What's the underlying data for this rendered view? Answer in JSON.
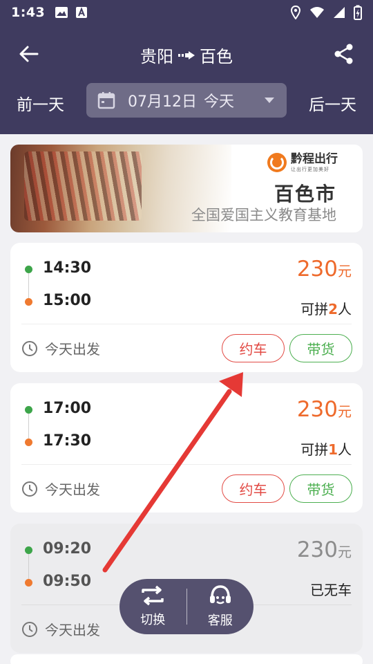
{
  "status_bar": {
    "time": "1:43"
  },
  "header": {
    "origin": "贵阳",
    "destination": "百色",
    "prev_day": "前一天",
    "next_day": "后一天",
    "date": "07月12日",
    "date_tag": "今天"
  },
  "banner": {
    "brand": "黔程出行",
    "brand_sub": "让出行更加美好",
    "city": "百色市",
    "slogan": "全国爱国主义教育基地"
  },
  "trips": [
    {
      "depart_time": "14:30",
      "arrive_time": "15:00",
      "price": "230",
      "unit": "元",
      "seats_prefix": "可拼",
      "seats_count": "2",
      "seats_suffix": "人",
      "depart_label": "今天出发",
      "book_label": "约车",
      "cargo_label": "带货"
    },
    {
      "depart_time": "17:00",
      "arrive_time": "17:30",
      "price": "230",
      "unit": "元",
      "seats_prefix": "可拼",
      "seats_count": "1",
      "seats_suffix": "人",
      "depart_label": "今天出发",
      "book_label": "约车",
      "cargo_label": "带货"
    },
    {
      "depart_time": "09:20",
      "arrive_time": "09:50",
      "price": "230",
      "unit": "元",
      "status": "已无车",
      "depart_label": "今天出发"
    }
  ],
  "float_bar": {
    "switch_label": "切换",
    "service_label": "客服"
  },
  "colors": {
    "header_bg": "#3f3b5f",
    "price": "#ee6a2c",
    "book": "#e24a44",
    "cargo": "#4caf50",
    "annotation_arrow": "#e53935"
  }
}
